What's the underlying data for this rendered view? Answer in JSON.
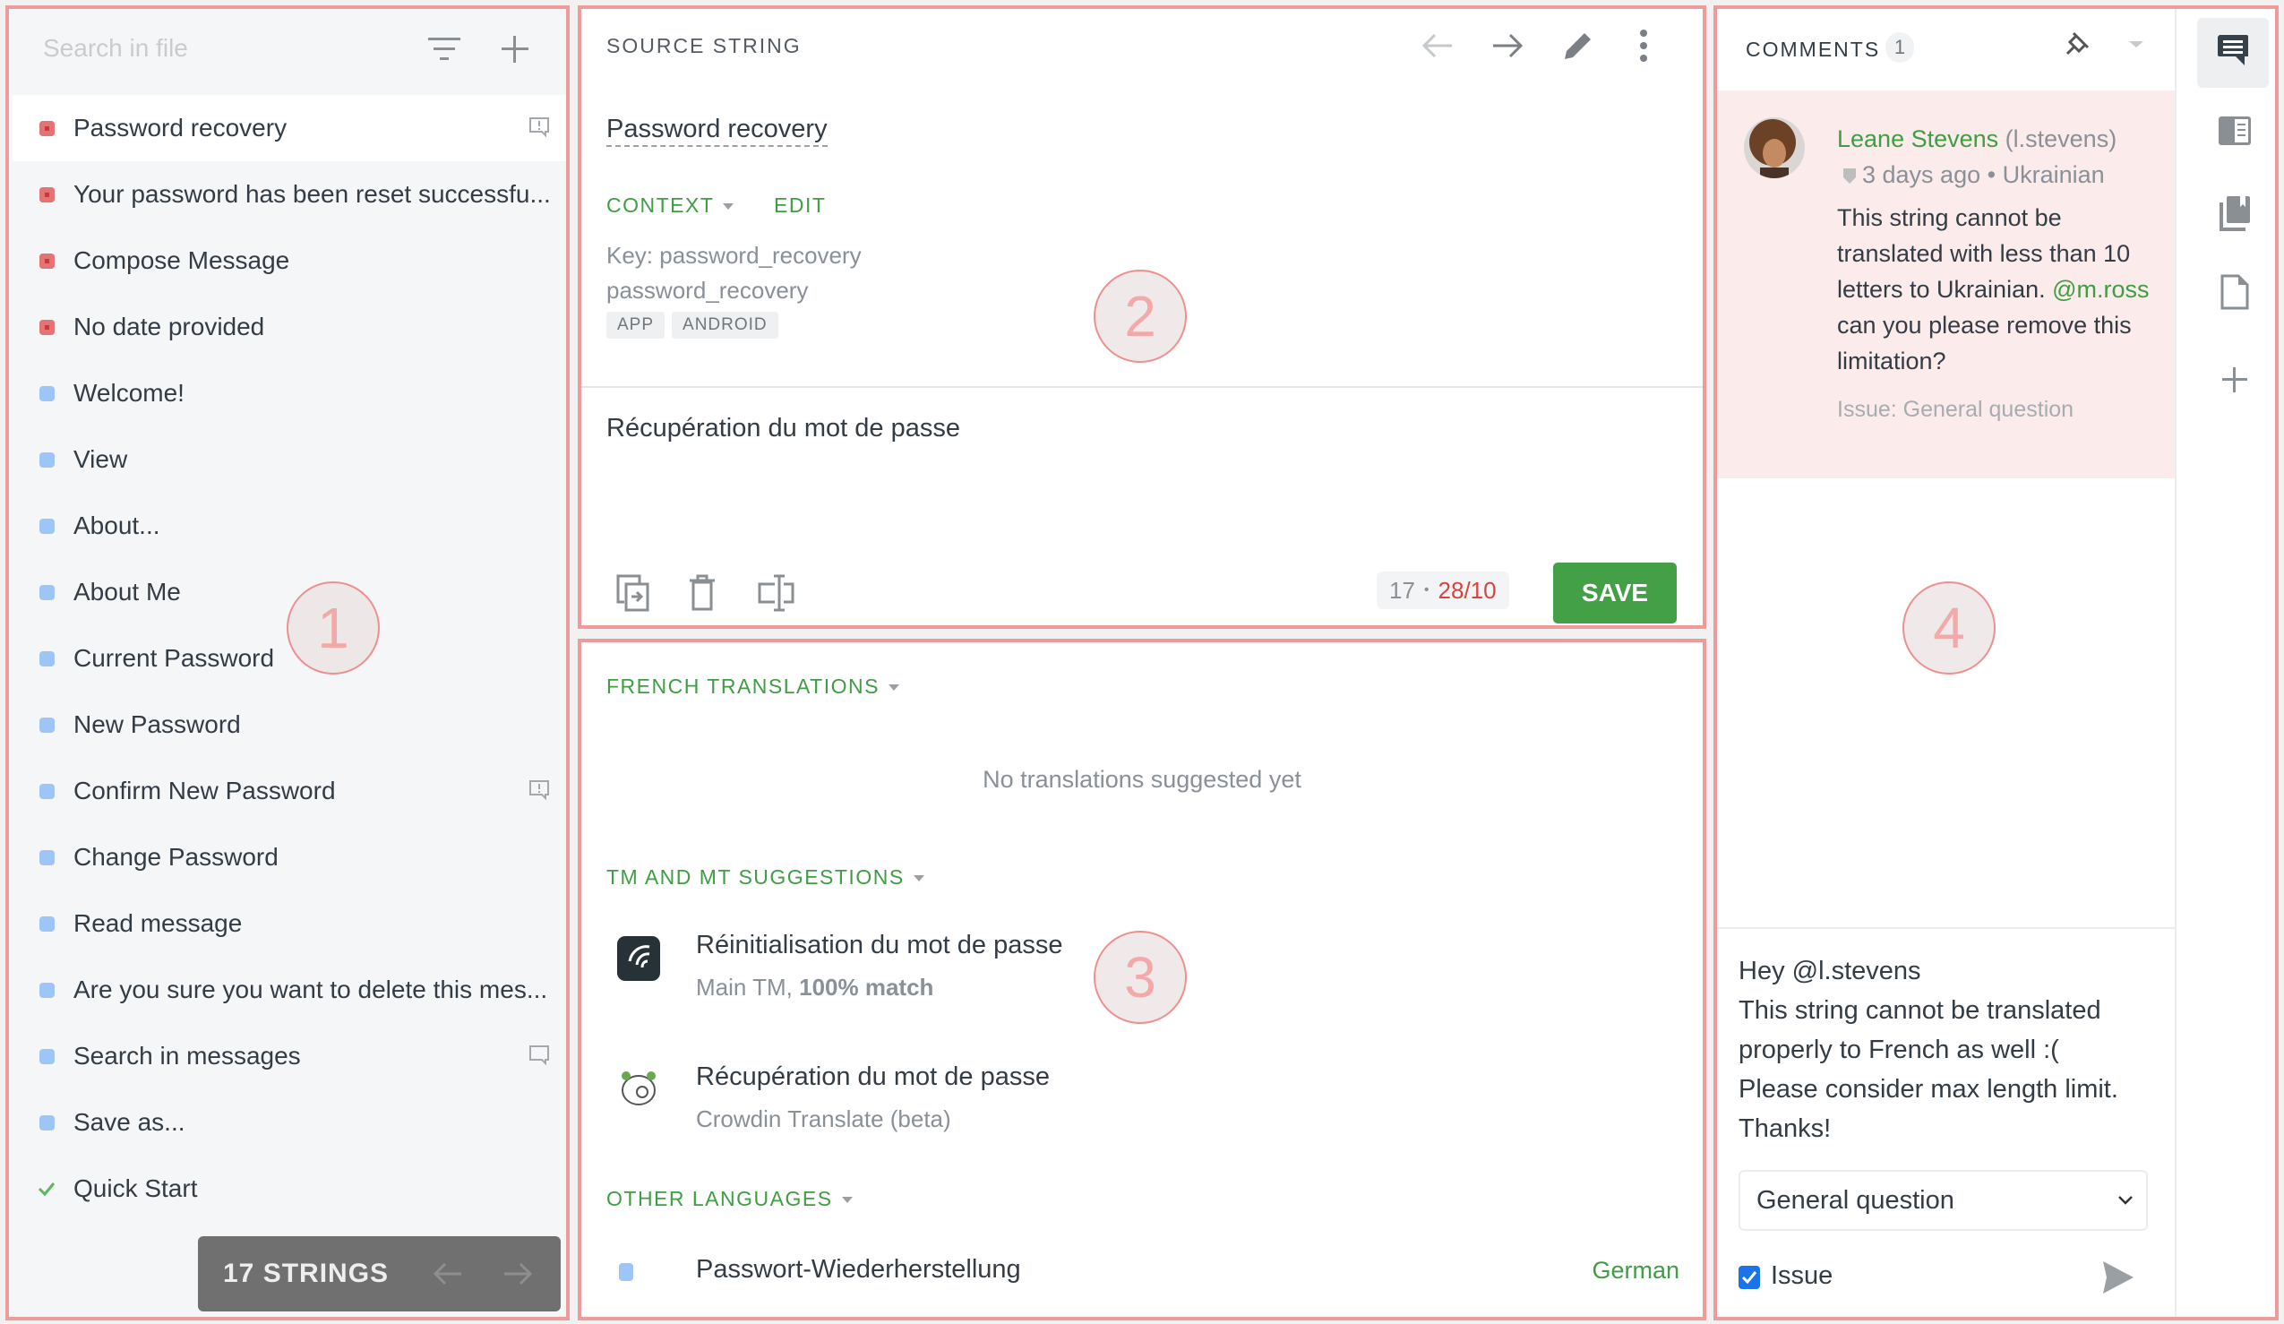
{
  "strings_panel": {
    "search_placeholder": "Search in file",
    "items": [
      {
        "label": "Password recovery",
        "status": "untranslated",
        "icon": "issue-comment-icon",
        "active": true
      },
      {
        "label": "Your password has been reset successfu...",
        "status": "untranslated"
      },
      {
        "label": "Compose Message",
        "status": "untranslated"
      },
      {
        "label": "No date provided",
        "status": "untranslated"
      },
      {
        "label": "Welcome!",
        "status": "translated"
      },
      {
        "label": "View",
        "status": "translated"
      },
      {
        "label": "About...",
        "status": "translated"
      },
      {
        "label": "About Me",
        "status": "translated"
      },
      {
        "label": "Current Password",
        "status": "translated"
      },
      {
        "label": "New Password",
        "status": "translated"
      },
      {
        "label": "Confirm New Password",
        "status": "translated",
        "icon": "issue-comment-icon"
      },
      {
        "label": "Change Password",
        "status": "translated"
      },
      {
        "label": "Read message",
        "status": "translated"
      },
      {
        "label": "Are you sure you want to delete this mes...",
        "status": "translated"
      },
      {
        "label": "Search in messages",
        "status": "translated",
        "icon": "comment-icon"
      },
      {
        "label": "Save as...",
        "status": "translated"
      },
      {
        "label": "Quick Start",
        "status": "approved"
      }
    ],
    "count_label": "17 STRINGS"
  },
  "source": {
    "header": "SOURCE STRING",
    "text": "Password recovery",
    "context_label": "CONTEXT",
    "edit_label": "EDIT",
    "key_line": "Key: password_recovery",
    "context_line": "password_recovery",
    "tags": [
      "APP",
      "ANDROID"
    ],
    "translation": "Récupération du mot de passe",
    "counter_source": "17",
    "counter_sep": "•",
    "counter_limit": "28/10",
    "save_label": "SAVE"
  },
  "suggestions": {
    "french_header": "FRENCH TRANSLATIONS",
    "empty": "No translations suggested yet",
    "tm_header": "TM AND MT SUGGESTIONS",
    "items": [
      {
        "text": "Réinitialisation du mot de passe",
        "source_prefix": "Main TM, ",
        "source_match": "100% match",
        "icon": "crowdin-tm-icon"
      },
      {
        "text": "Récupération du mot de passe",
        "source_prefix": "Crowdin Translate (beta)",
        "source_match": "",
        "icon": "crowdin-translate-icon"
      }
    ],
    "other_header": "OTHER LANGUAGES",
    "other": [
      {
        "text": "Passwort-Wiederherstellung",
        "language": "German"
      }
    ]
  },
  "comments": {
    "header": "COMMENTS",
    "count": "1",
    "comment": {
      "author": "Leane Stevens",
      "username": "(l.stevens)",
      "time": "3 days ago",
      "language": "Ukrainian",
      "text_before": "This string cannot be translated with less than 10 letters to Ukrainian.",
      "mention": "@m.ross",
      "text_after": " can you please remove this limitation?",
      "issue": "Issue: General question"
    },
    "reply_lines": [
      "Hey @l.stevens",
      "This string cannot be translated",
      "properly to French as well :(",
      "Please consider max length limit.",
      "Thanks!"
    ],
    "issue_type": "General question",
    "issue_checkbox_label": "Issue",
    "issue_checked": true
  },
  "rail": [
    "comments-icon",
    "sidebar-panel-icon",
    "glossary-icon",
    "file-icon",
    "add-icon"
  ],
  "markers": [
    "1",
    "2",
    "3",
    "4"
  ],
  "colors": {
    "accent": "#3f9d43",
    "untranslated": "#e57373",
    "translated": "#9ec5f8",
    "limit_exceeded": "#d8433b",
    "annotation": "#f09b9b"
  }
}
